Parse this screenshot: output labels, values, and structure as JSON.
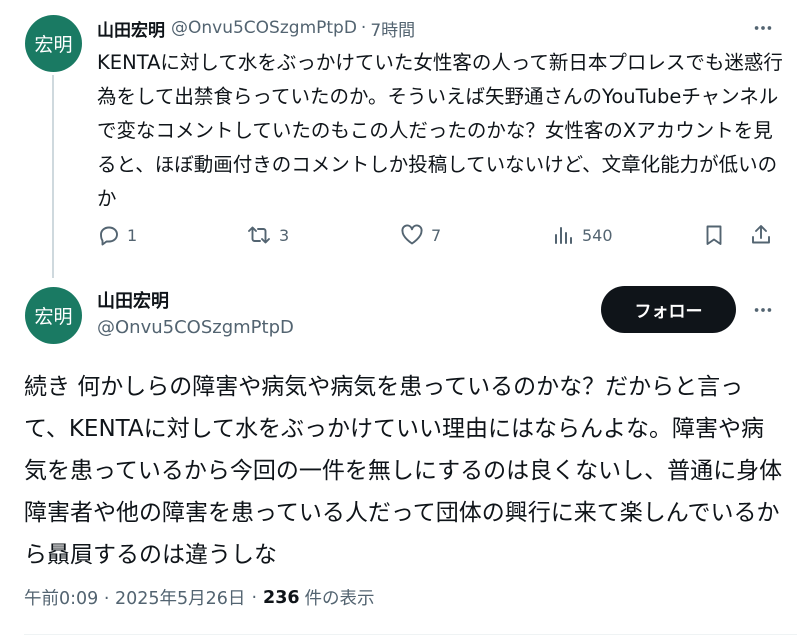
{
  "parent_tweet": {
    "avatar_text": "宏明",
    "display_name": "山田宏明",
    "handle": "@Onvu5COSzgmPtpD",
    "separator": "·",
    "time": "7時間",
    "text": "KENTAに対して水をぶっかけていた女性客の人って新日本プロレスでも迷惑行為をして出禁食らっていたのか。そういえば矢野通さんのYouTubeチャンネルで変なコメントしていたのもこの人だったのかな？女性客のXアカウントを見ると、ほぼ動画付きのコメントしか投稿していないけど、文章化能力が低いのか",
    "actions": {
      "reply_count": "1",
      "retweet_count": "3",
      "like_count": "7",
      "views_count": "540"
    }
  },
  "main_tweet": {
    "avatar_text": "宏明",
    "display_name": "山田宏明",
    "handle": "@Onvu5COSzgmPtpD",
    "follow_label": "フォロー",
    "text": "続き 何かしらの障害や病気や病気を患っているのかな？だからと言って、KENTAに対して水をぶっかけていい理由にはならんよな。障害や病気を患っているから今回の一件を無しにするのは良くないし、普通に身体障害者や他の障害を患っている人だって団体の興行に来て楽しんでいるから贔屓するのは違うしな",
    "timestamp": "午前0:09 · 2025年5月26日",
    "separator": "·",
    "views_count": "236",
    "views_label": "件の表示"
  },
  "colors": {
    "avatar_bg": "#1a7a63",
    "text_primary": "#0f1419",
    "text_secondary": "#536471",
    "follow_bg": "#0f1419",
    "thread_line": "#cfd9de"
  },
  "icons": [
    "more-icon",
    "reply-icon",
    "retweet-icon",
    "like-icon",
    "views-icon",
    "bookmark-icon",
    "share-icon"
  ]
}
